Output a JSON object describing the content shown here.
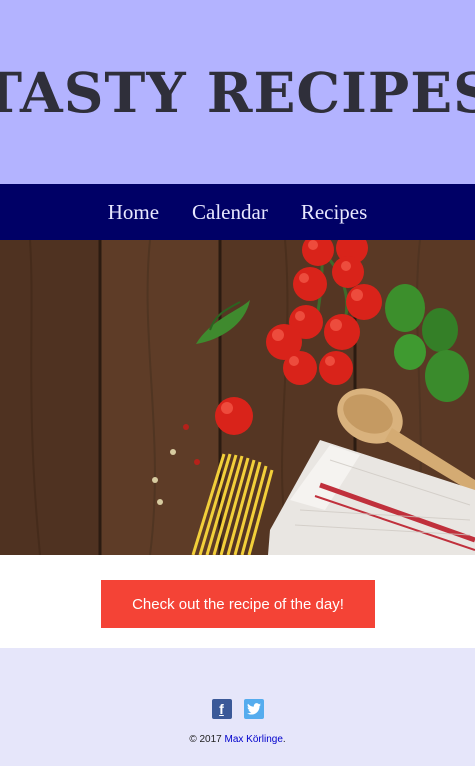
{
  "header": {
    "title": "TASTY RECIPES"
  },
  "nav": {
    "items": [
      "Home",
      "Calendar",
      "Recipes"
    ]
  },
  "hero": {
    "image": "wooden-table-with-tomatoes-basil-spoon-spaghetti-towel"
  },
  "cta": {
    "label": "Check out the recipe of the day!"
  },
  "footer": {
    "social": [
      "facebook-icon",
      "twitter-icon"
    ],
    "copyright_prefix": "© 2017",
    "author": "Max Körlinge",
    "copyright_suffix": "."
  },
  "colors": {
    "header_bg": "#b3b3ff",
    "nav_bg": "#000066",
    "cta_bg": "#f44336",
    "footer_bg": "#e6e6fa"
  }
}
